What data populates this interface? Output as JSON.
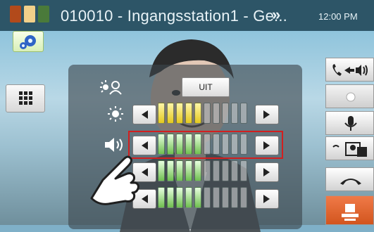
{
  "header": {
    "title": "010010 - Ingangsstation1 - Ge...",
    "chevron_icon": "double-chevron-right-icon",
    "time": "12:00 PM",
    "status_colors": [
      "#b24a1b",
      "#f2d08a",
      "#4a7a3a"
    ]
  },
  "buttons": {
    "settings_icon": "gear-icon",
    "keypad_icon": "keypad-icon",
    "uit_label": "UIT"
  },
  "controls": {
    "rows": [
      {
        "name": "camera-light",
        "icon": "person-light-icon",
        "arrows": false
      },
      {
        "name": "brightness",
        "icon": "sun-icon",
        "arrows": true,
        "level": 0.5,
        "color": "yellow"
      },
      {
        "name": "speaker-volume",
        "icon": "speaker-icon",
        "arrows": true,
        "level": 0.5,
        "color": "green"
      },
      {
        "name": "mic-volume",
        "icon": "microphone-icon",
        "arrows": true,
        "level": 0.5,
        "color": "green"
      },
      {
        "name": "ring-volume",
        "icon": "ring-icon",
        "arrows": true,
        "level": 0.5,
        "color": "green"
      }
    ]
  },
  "right_panel": {
    "items": [
      {
        "icon": "call-speaker-icon"
      },
      {
        "icon": "record-icon"
      },
      {
        "icon": "microphone-icon"
      },
      {
        "icon": "transfer-icon"
      },
      {
        "icon": "hangup-icon"
      },
      {
        "icon": "unlock-icon"
      }
    ]
  }
}
